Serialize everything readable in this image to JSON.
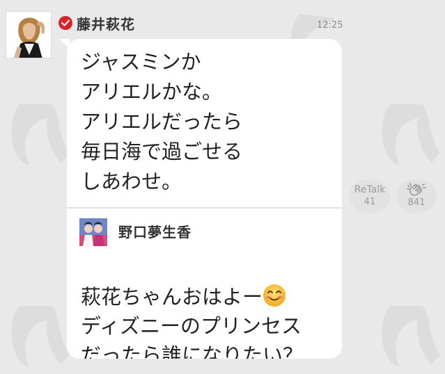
{
  "post": {
    "author": "藤井萩花",
    "time": "12:25",
    "message": "ジャスミンか\nアリエルかな。\nアリエルだったら\n毎日海で過ごせる\nしあわせ。"
  },
  "quote": {
    "author": "野口夢生香",
    "text_line1": "萩花ちゃんおはよー",
    "text_rest": "ディズニーのプリンセス\nだったら誰になりたい？"
  },
  "actions": {
    "retalk_label": "ReTalk",
    "retalk_count": "41",
    "clap_count": "841"
  },
  "colors": {
    "background": "#e9e9e9",
    "bubble": "#ffffff",
    "verified": "#d8232a",
    "text": "#222222",
    "muted": "#8a8a8a"
  }
}
